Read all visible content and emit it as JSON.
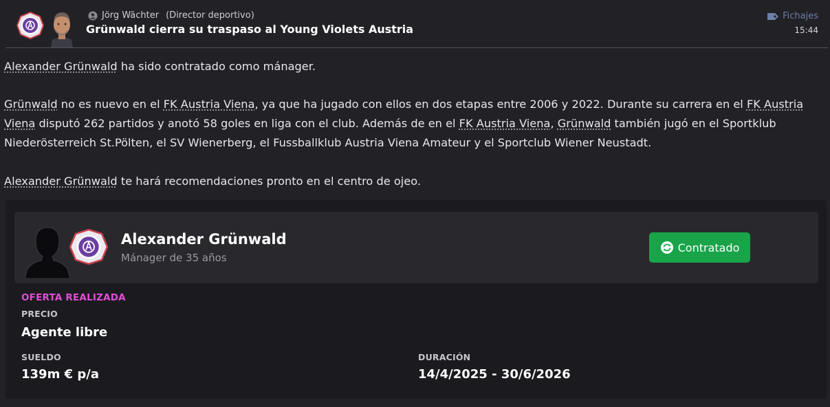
{
  "header": {
    "sender_name": "Jörg Wächter",
    "sender_role": "(Director deportivo)",
    "headline": "Grünwald cierra su traspaso al Young Violets Austria",
    "category": "Fichajes",
    "time": "15:44"
  },
  "body": {
    "p1": {
      "name": "Alexander Grünwald",
      "text": " ha sido contratado como mánager."
    },
    "p2": {
      "s1": "Grünwald",
      "s2": " no es nuevo en el ",
      "s3": "FK Austria Viena",
      "s4": ", ya que ha jugado con ellos en dos etapas entre 2006 y 2022. Durante su carrera en el ",
      "s5": "FK Austria Viena",
      "s6": " disputó 262 partidos y anotó 58 goles en liga con el club. Además de en el ",
      "s7": "FK Austria Viena",
      "s8": ", ",
      "s9": "Grünwald",
      "s10": " también jugó en el Sportklub Niederösterreich St.Pölten, el SV Wienerberg, el Fussballklub Austria Viena Amateur y el Sportclub Wiener Neustadt."
    },
    "p3": {
      "name": "Alexander Grünwald",
      "text": " te hará recomendaciones pronto en el centro de ojeo."
    }
  },
  "card": {
    "player_name": "Alexander Grünwald",
    "player_sub": "Mánager de 35 años",
    "status_label": "Contratado",
    "offer_title": "OFERTA REALIZADA",
    "precio_label": "PRECIO",
    "precio_value": "Agente libre",
    "sueldo_label": "SUELDO",
    "sueldo_value": "139m € p/a",
    "duracion_label": "DURACIÓN",
    "duracion_value": "14/4/2025 - 30/6/2026"
  },
  "colors": {
    "background": "#222126",
    "card": "#1b1a1e",
    "card_header": "#29282d",
    "accent_green": "#19a449",
    "offer_magenta": "#e04fd6",
    "category_blue": "#6d7fa8",
    "club_purple": "#6b3fa0"
  },
  "icons": [
    "club-badge-icon",
    "person-icon",
    "tag-icon",
    "refresh-icon",
    "silhouette-icon"
  ]
}
